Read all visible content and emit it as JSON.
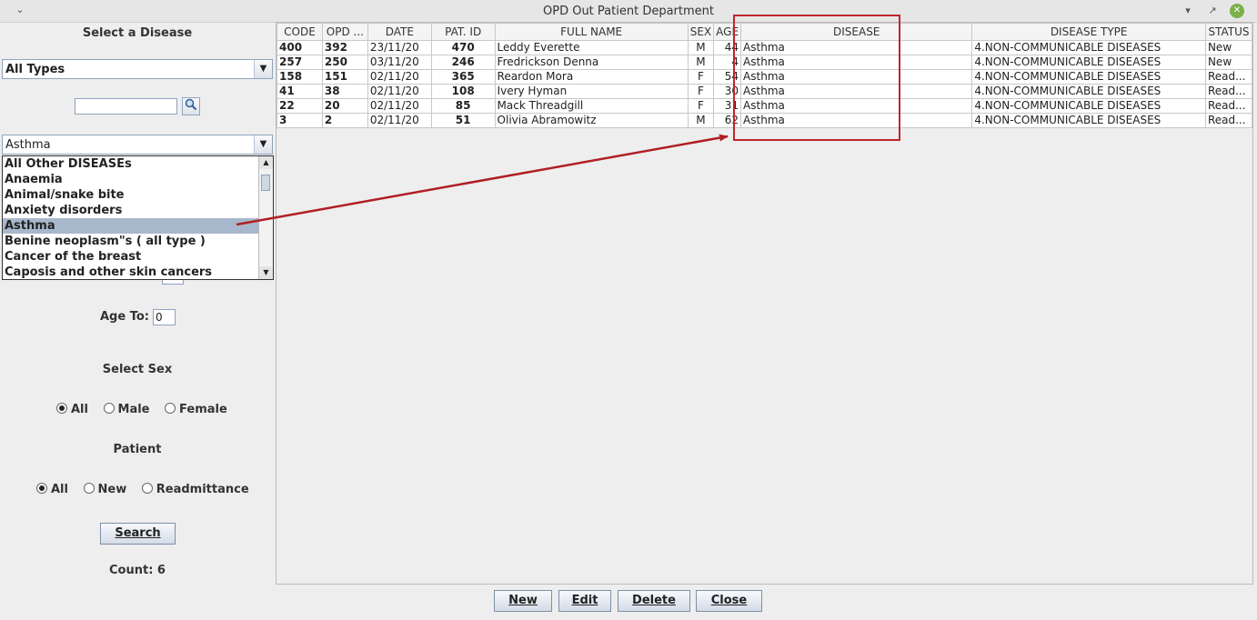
{
  "window": {
    "title": "OPD Out Patient Department",
    "menu_glyph": "⌄",
    "minimize_glyph": "▾",
    "maximize_glyph": "↗",
    "close_glyph": "✕"
  },
  "left": {
    "select_disease_title": "Select a Disease",
    "type_combo_value": "All Types",
    "search_field_value": "",
    "disease_combo_value": "Asthma",
    "disease_options": [
      "All Other DISEASEs",
      "Anaemia",
      "Animal/snake bite",
      "Anxiety disorders",
      "Asthma",
      "Benine neoplasm\"s ( all type )",
      "Cancer of the breast",
      "Caposis and other skin cancers"
    ],
    "selected_index": 4,
    "age_to_label": "Age To:",
    "age_to_value": "0",
    "select_sex_title": "Select Sex",
    "sex_options": [
      "All",
      "Male",
      "Female"
    ],
    "patient_title": "Patient",
    "patient_options": [
      "All",
      "New",
      "Readmittance"
    ],
    "search_button": "Search",
    "count_label": "Count: 6"
  },
  "table": {
    "columns": [
      "CODE",
      "OPD ...",
      "DATE",
      "PAT. ID",
      "FULL NAME",
      "SEX",
      "AGE",
      "DISEASE",
      "DISEASE TYPE",
      "STATUS"
    ],
    "rows": [
      [
        "400",
        "392",
        "23/11/20",
        "470",
        "Leddy Everette",
        "M",
        "44",
        "Asthma",
        "4.NON-COMMUNICABLE DISEASES",
        "New"
      ],
      [
        "257",
        "250",
        "03/11/20",
        "246",
        "Fredrickson Denna",
        "M",
        "4",
        "Asthma",
        "4.NON-COMMUNICABLE DISEASES",
        "New"
      ],
      [
        "158",
        "151",
        "02/11/20",
        "365",
        "Reardon Mora",
        "F",
        "54",
        "Asthma",
        "4.NON-COMMUNICABLE DISEASES",
        "Read..."
      ],
      [
        "41",
        "38",
        "02/11/20",
        "108",
        "Ivery Hyman",
        "F",
        "30",
        "Asthma",
        "4.NON-COMMUNICABLE DISEASES",
        "Read..."
      ],
      [
        "22",
        "20",
        "02/11/20",
        "85",
        "Mack Threadgill",
        "F",
        "31",
        "Asthma",
        "4.NON-COMMUNICABLE DISEASES",
        "Read..."
      ],
      [
        "3",
        "2",
        "02/11/20",
        "51",
        "Olivia Abramowitz",
        "M",
        "62",
        "Asthma",
        "4.NON-COMMUNICABLE DISEASES",
        "Read..."
      ]
    ]
  },
  "buttons": {
    "new": "New",
    "edit": "Edit",
    "delete": "Delete",
    "close": "Close"
  },
  "colors": {
    "annotation": "#c0262a",
    "selection": "#a8b8cc"
  }
}
